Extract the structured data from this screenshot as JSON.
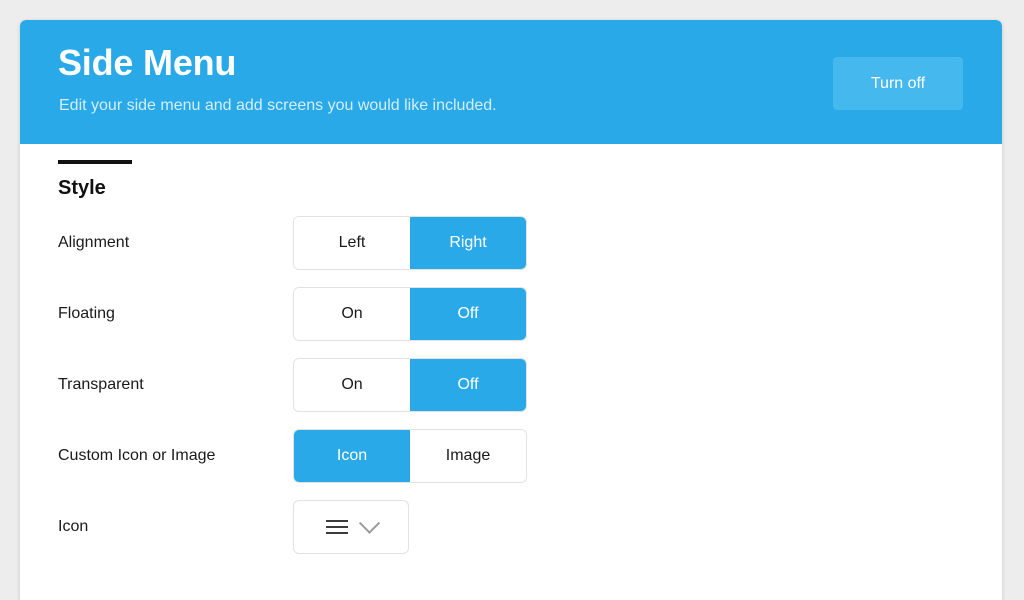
{
  "header": {
    "title": "Side Menu",
    "subtitle": "Edit your side menu and add screens you would like included.",
    "action_label": "Turn off",
    "background_color": "#29a9e8",
    "action_background_color": "#45b8ee"
  },
  "section": {
    "title": "Style"
  },
  "rows": [
    {
      "label": "Alignment",
      "control": "segmented",
      "options": [
        "Left",
        "Right"
      ],
      "selected": "Right"
    },
    {
      "label": "Floating",
      "control": "segmented",
      "options": [
        "On",
        "Off"
      ],
      "selected": "Off"
    },
    {
      "label": "Transparent",
      "control": "segmented",
      "options": [
        "On",
        "Off"
      ],
      "selected": "Off"
    },
    {
      "label": "Custom Icon or Image",
      "control": "segmented",
      "options": [
        "Icon",
        "Image"
      ],
      "selected": "Icon"
    },
    {
      "label": "Icon",
      "control": "select",
      "value_icon": "hamburger-icon",
      "chevron_icon": "chevron-down-icon"
    }
  ],
  "colors": {
    "page_background": "#ededed",
    "accent": "#29a9e8",
    "text": "#1a1a1a"
  }
}
